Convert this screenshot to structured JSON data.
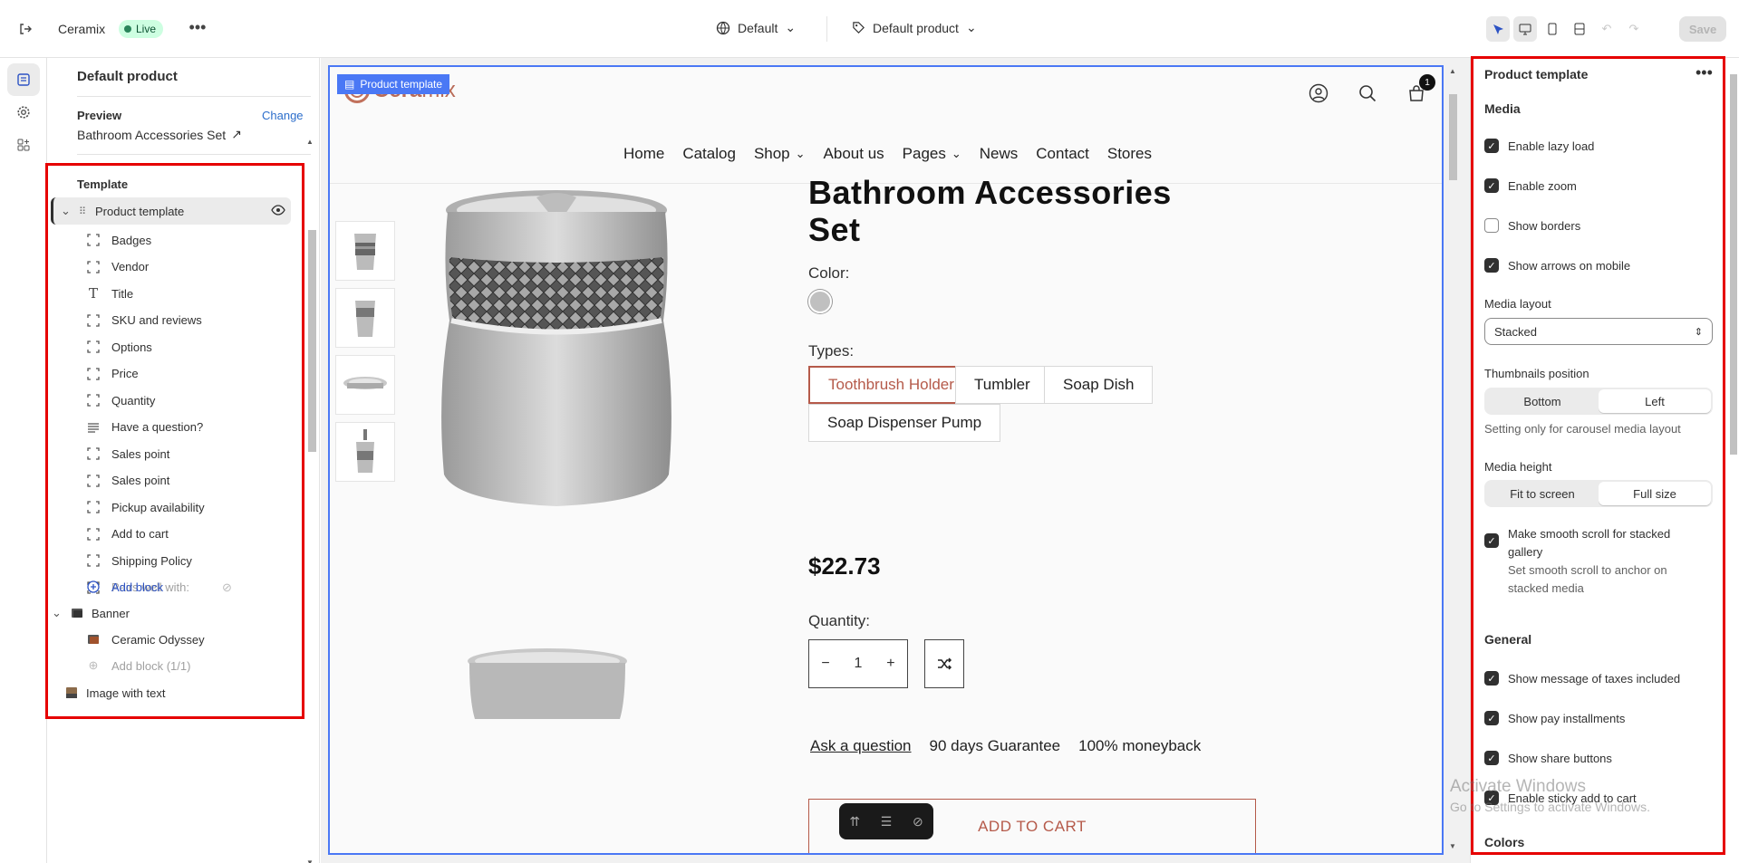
{
  "topbar": {
    "store_name": "Ceramix",
    "status": "Live",
    "theme": "Default",
    "template": "Default product",
    "save_label": "Save"
  },
  "sidebar": {
    "title": "Default product",
    "preview_label": "Preview",
    "change_label": "Change",
    "product_name": "Bathroom Accessories Set",
    "template_label": "Template",
    "product_template": "Product template",
    "blocks": [
      {
        "label": "Badges",
        "icon": "block-icon"
      },
      {
        "label": "Vendor",
        "icon": "block-icon"
      },
      {
        "label": "Title",
        "icon": "text-icon"
      },
      {
        "label": "SKU and reviews",
        "icon": "block-icon"
      },
      {
        "label": "Options",
        "icon": "block-icon"
      },
      {
        "label": "Price",
        "icon": "block-icon"
      },
      {
        "label": "Quantity",
        "icon": "block-icon"
      },
      {
        "label": "Have a question?",
        "icon": "paragraph-icon"
      },
      {
        "label": "Sales point",
        "icon": "block-icon"
      },
      {
        "label": "Sales point",
        "icon": "block-icon"
      },
      {
        "label": "Pickup availability",
        "icon": "block-icon"
      },
      {
        "label": "Add to cart",
        "icon": "block-icon"
      },
      {
        "label": "Shipping Policy",
        "icon": "block-icon"
      },
      {
        "label": "Pairs well with:",
        "icon": "block-icon"
      }
    ],
    "add_block": "Add block",
    "banner": "Banner",
    "banner_child": "Ceramic Odyssey",
    "banner_add": "Add block (1/1)",
    "image_with_text": "Image with text"
  },
  "canvas": {
    "tag": "Product template",
    "logo_bold": "Cera",
    "logo_light": "mix",
    "cart_count": "1",
    "nav": [
      "Home",
      "Catalog",
      "Shop",
      "About us",
      "Pages",
      "News",
      "Contact",
      "Stores"
    ],
    "product_title": "Bathroom Accessories Set",
    "color_label": "Color:",
    "types_label": "Types:",
    "types": [
      "Toothbrush Holder",
      "Tumbler",
      "Soap Dish",
      "Soap Dispenser Pump"
    ],
    "price": "$22.73",
    "quantity_label": "Quantity:",
    "quantity": "1",
    "ask": "Ask a question",
    "guarantee": "90 days Guarantee",
    "moneyback": "100% moneyback",
    "add_to_cart": "ADD TO CART"
  },
  "panel": {
    "title": "Product template",
    "media": "Media",
    "lazy": "Enable lazy load",
    "zoom": "Enable zoom",
    "borders": "Show borders",
    "arrows": "Show arrows on mobile",
    "layout_label": "Media layout",
    "layout_value": "Stacked",
    "thumbs_label": "Thumbnails position",
    "thumbs_opts": [
      "Bottom",
      "Left"
    ],
    "thumbs_help": "Setting only for carousel media layout",
    "height_label": "Media height",
    "height_opts": [
      "Fit to screen",
      "Full size"
    ],
    "smooth": "Make smooth scroll for stacked gallery",
    "smooth_help": "Set smooth scroll to anchor on stacked media",
    "general": "General",
    "taxes": "Show message of taxes included",
    "installments": "Show pay installments",
    "share": "Show share buttons",
    "sticky": "Enable sticky add to cart",
    "colors": "Colors"
  },
  "watermark": {
    "line1": "Activate Windows",
    "line2": "Go to Settings to activate Windows."
  }
}
